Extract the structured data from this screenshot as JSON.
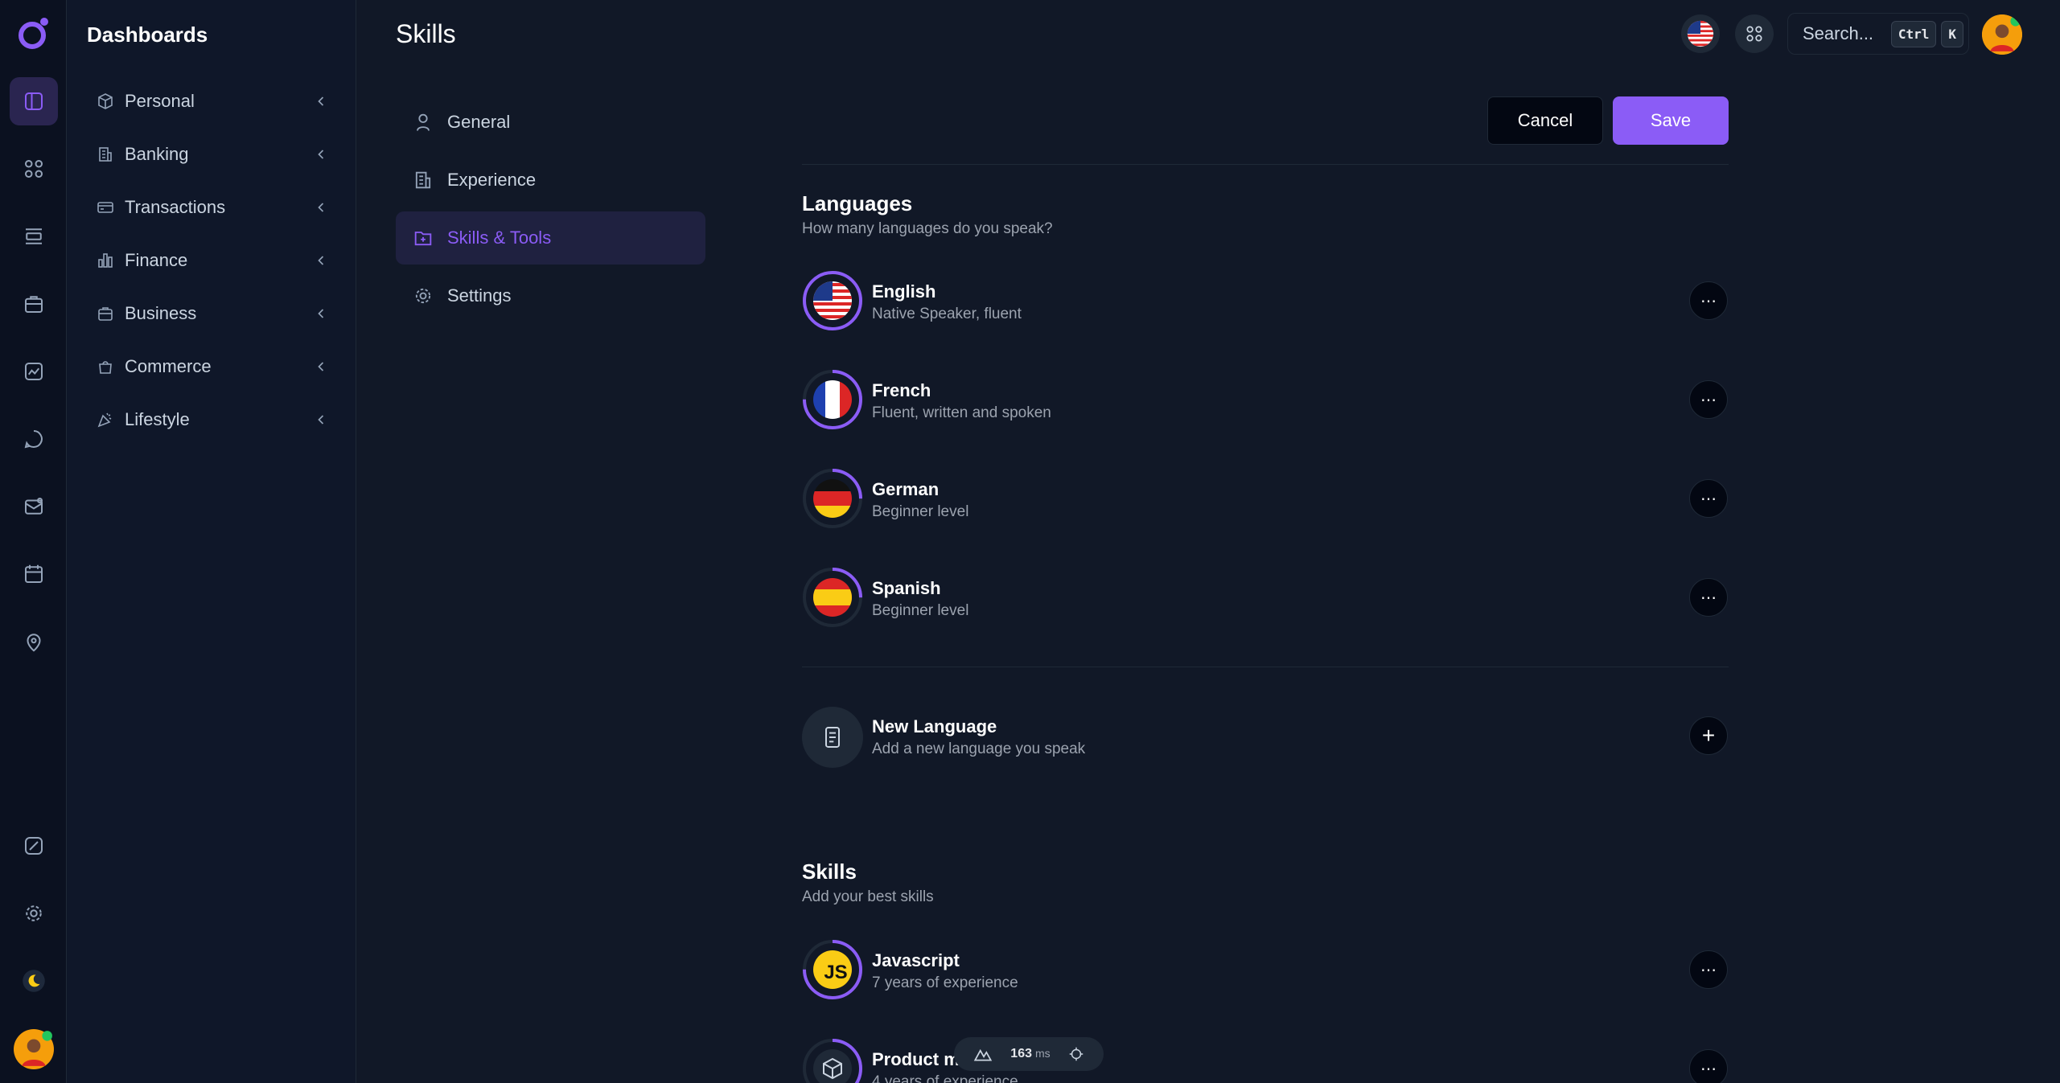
{
  "sidebar": {
    "title": "Dashboards",
    "items": [
      {
        "label": "Personal",
        "icon": "cube-icon"
      },
      {
        "label": "Banking",
        "icon": "building-icon"
      },
      {
        "label": "Transactions",
        "icon": "card-icon"
      },
      {
        "label": "Finance",
        "icon": "chart-icon"
      },
      {
        "label": "Business",
        "icon": "briefcase-icon"
      },
      {
        "label": "Commerce",
        "icon": "basket-icon"
      },
      {
        "label": "Lifestyle",
        "icon": "party-icon"
      }
    ]
  },
  "header": {
    "title": "Skills",
    "search_placeholder": "Search...",
    "kbd_ctrl": "Ctrl",
    "kbd_k": "K"
  },
  "settings_nav": [
    {
      "label": "General",
      "icon": "user-icon"
    },
    {
      "label": "Experience",
      "icon": "building-icon"
    },
    {
      "label": "Skills & Tools",
      "icon": "folder-plus-icon",
      "active": true
    },
    {
      "label": "Settings",
      "icon": "gear-icon"
    }
  ],
  "actions": {
    "cancel": "Cancel",
    "save": "Save"
  },
  "languages": {
    "title": "Languages",
    "subtitle": "How many languages do you speak?",
    "items": [
      {
        "name": "English",
        "desc": "Native Speaker, fluent",
        "progress": 1.0,
        "flag": "us"
      },
      {
        "name": "French",
        "desc": "Fluent, written and spoken",
        "progress": 0.75,
        "flag": "fr"
      },
      {
        "name": "German",
        "desc": "Beginner level",
        "progress": 0.25,
        "flag": "de"
      },
      {
        "name": "Spanish",
        "desc": "Beginner level",
        "progress": 0.25,
        "flag": "es"
      }
    ],
    "new": {
      "name": "New Language",
      "desc": "Add a new language you speak"
    }
  },
  "skills": {
    "title": "Skills",
    "subtitle": "Add your best skills",
    "items": [
      {
        "name": "Javascript",
        "desc": "7 years of experience",
        "progress": 0.75,
        "logo": "JS"
      },
      {
        "name": "Product m",
        "desc": "4 years of experience",
        "progress": 0.5
      }
    ]
  },
  "perf": {
    "value": "163",
    "unit": "ms"
  },
  "colors": {
    "accent": "#8b5cf6",
    "bg": "#111827",
    "rail": "#0b1120"
  }
}
